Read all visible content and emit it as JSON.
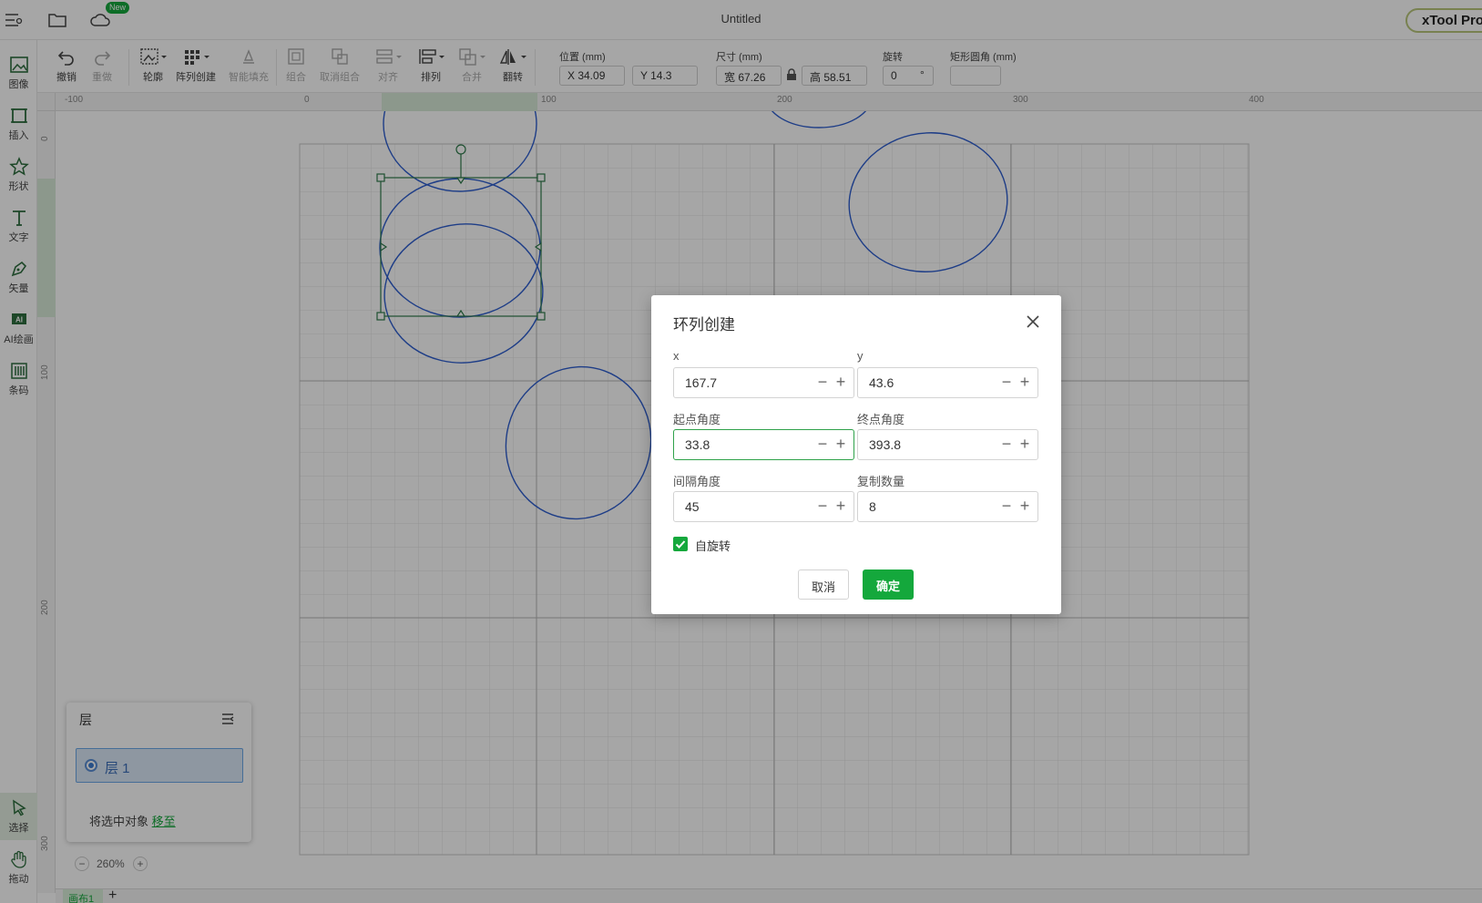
{
  "titlebar": {
    "menu_icon": "menu-lines-icon",
    "folder_icon": "folder-icon",
    "cloud_icon": "cloud-icon",
    "new_badge": "New",
    "doc_title": "Untitled",
    "brand": "xTool Pro"
  },
  "leftrail": {
    "items": [
      {
        "label": "图像",
        "icon": "image-icon"
      },
      {
        "label": "插入",
        "icon": "insert-icon"
      },
      {
        "label": "形状",
        "icon": "shape-star-icon"
      },
      {
        "label": "文字",
        "icon": "text-icon"
      },
      {
        "label": "矢量",
        "icon": "pen-icon"
      },
      {
        "label": "AI绘画",
        "icon": "ai-icon"
      },
      {
        "label": "条码",
        "icon": "barcode-icon"
      }
    ],
    "bottom_items": [
      {
        "label": "选择",
        "icon": "select-cursor-icon"
      },
      {
        "label": "拖动",
        "icon": "hand-icon"
      }
    ]
  },
  "toolbar": {
    "undo": "撤销",
    "redo": "重做",
    "outline": "轮廓",
    "array_create": "阵列创建",
    "smart_fill": "智能填充",
    "group": "组合",
    "ungroup": "取消组合",
    "align": "对齐",
    "arrange": "排列",
    "merge": "合并",
    "flip": "翻转",
    "position_label": "位置 (mm)",
    "pos_x": "X 34.09",
    "pos_y": "Y 14.3",
    "size_label": "尺寸 (mm)",
    "width": "宽 67.26",
    "height": "高 58.51",
    "rotate_label": "旋转",
    "rotate_value": "0",
    "rotate_unit": "°",
    "corner_label": "矩形圆角 (mm)",
    "corner_value": ""
  },
  "ruler": {
    "top": [
      "-100",
      "0",
      "100",
      "200",
      "300",
      "400"
    ],
    "left": [
      "0",
      "100",
      "200",
      "300"
    ]
  },
  "layers": {
    "title": "层",
    "layer_name": "层 1",
    "move_text": "将选中对象",
    "move_link": "移至"
  },
  "zoom": {
    "minus": "−",
    "value": "260%",
    "plus": "+"
  },
  "tabs": {
    "canvas_tab": "画布1",
    "add": "+"
  },
  "dialog": {
    "title": "环列创建",
    "x_label": "x",
    "x_value": "167.7",
    "y_label": "y",
    "y_value": "43.6",
    "start_label": "起点角度",
    "start_value": "33.8",
    "end_label": "终点角度",
    "end_value": "393.8",
    "interval_label": "间隔角度",
    "interval_value": "45",
    "count_label": "复制数量",
    "count_value": "8",
    "self_rotate_label": "自旋转",
    "self_rotate_checked": true,
    "cancel": "取消",
    "ok": "确定"
  },
  "colors": {
    "accent": "#14a83c",
    "shape_stroke": "#2e5fd0",
    "selection": "#2d7a4a"
  }
}
